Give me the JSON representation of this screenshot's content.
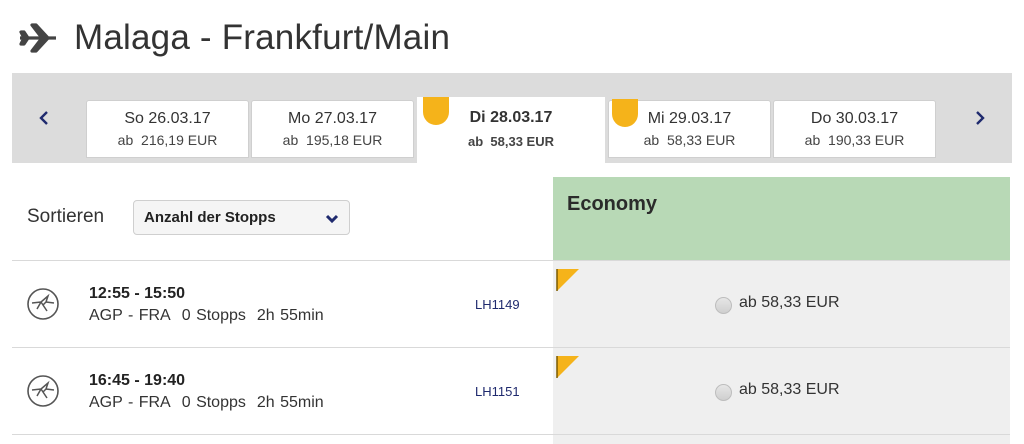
{
  "header": {
    "title": "Malaga - Frankfurt/Main",
    "icon": "airplane-icon"
  },
  "date_strip": {
    "prev_icon": "chevron-left-icon",
    "next_icon": "chevron-right-icon",
    "tabs": [
      {
        "day": "So 26.03.17",
        "price_prefix": "ab",
        "price": "216,19 EUR",
        "active": false,
        "badge": false
      },
      {
        "day": "Mo 27.03.17",
        "price_prefix": "ab",
        "price": "195,18 EUR",
        "active": false,
        "badge": false
      },
      {
        "day": "Di 28.03.17",
        "price_prefix": "ab",
        "price": "58,33 EUR",
        "active": true,
        "badge": true
      },
      {
        "day": "Mi 29.03.17",
        "price_prefix": "ab",
        "price": "58,33 EUR",
        "active": false,
        "badge": true
      },
      {
        "day": "Do 30.03.17",
        "price_prefix": "ab",
        "price": "190,33 EUR",
        "active": false,
        "badge": false
      }
    ],
    "badge_color": "#f5b31a",
    "accent": "#1f2a6e"
  },
  "sort": {
    "label": "Sortieren",
    "selected": "Anzahl der Stopps",
    "icon": "chevron-down-icon"
  },
  "fare_class": {
    "label": "Economy",
    "color": "#b8d9b6"
  },
  "flights": [
    {
      "times": "12:55 - 15:50",
      "from_to": "AGP - FRA",
      "stops": "0 Stopps",
      "duration": "2h 55min",
      "flight_no": "LH1149",
      "fare": "ab 58,33 EUR",
      "airline_logo": "lufthansa-crane-icon"
    },
    {
      "times": "16:45 - 19:40",
      "from_to": "AGP - FRA",
      "stops": "0 Stopps",
      "duration": "2h 55min",
      "flight_no": "LH1151",
      "fare": "ab 58,33 EUR",
      "airline_logo": "lufthansa-crane-icon"
    }
  ]
}
